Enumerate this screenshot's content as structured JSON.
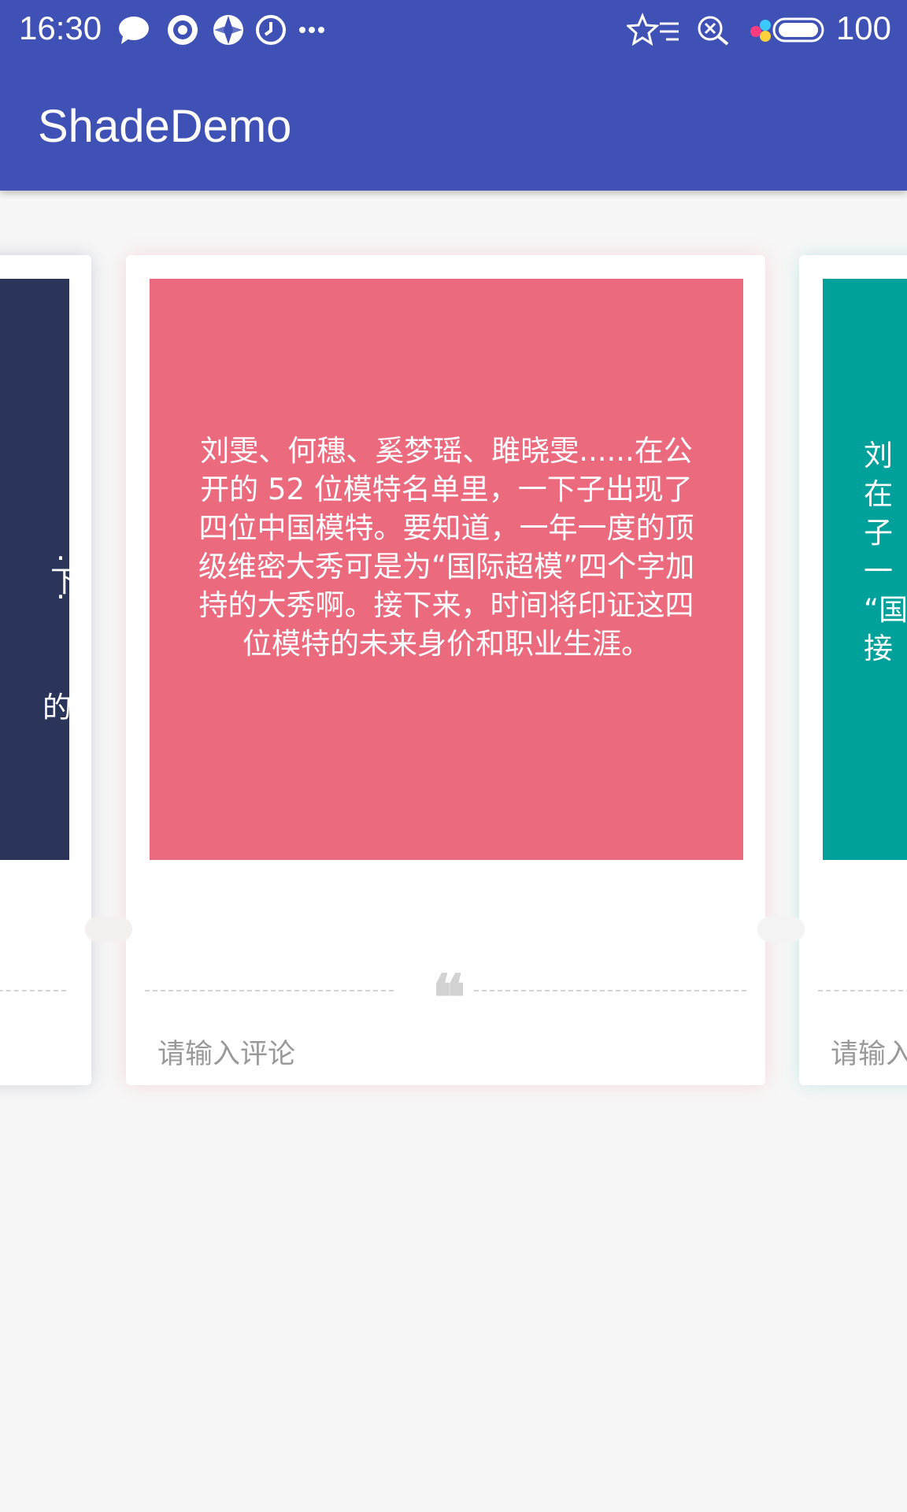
{
  "status_bar": {
    "time": "16:30",
    "left_icons": [
      "chat-bubble-icon",
      "target-icon",
      "aperture-icon",
      "clock-icon",
      "more-dots-icon"
    ],
    "right_icons": [
      "star-signal-icon",
      "search-off-icon",
      "color-dots-icon",
      "battery-icon"
    ],
    "battery": "100"
  },
  "app_bar": {
    "title": "ShadeDemo",
    "color": "#3f51b5"
  },
  "cards": [
    {
      "color": "#2b355a",
      "visible_text_fragments": [
        ". .",
        "下",
        "的"
      ],
      "comment_placeholder": ""
    },
    {
      "color": "#ec6a7d",
      "text": "刘雯、何穗、奚梦瑶、雎晓雯......在公开的 52 位模特名单里，一下子出现了四位中国模特。要知道，一年一度的顶级维密大秀可是为“国际超模”四个字加持的大秀啊。接下来，时间将印证这四位模特的未来身价和职业生涯。",
      "comment_placeholder": "请输入评论"
    },
    {
      "color": "#00a19b",
      "visible_text_fragments": [
        "刘",
        "在",
        "子",
        "一",
        "“国",
        "接"
      ],
      "comment_placeholder": "请输入"
    }
  ]
}
